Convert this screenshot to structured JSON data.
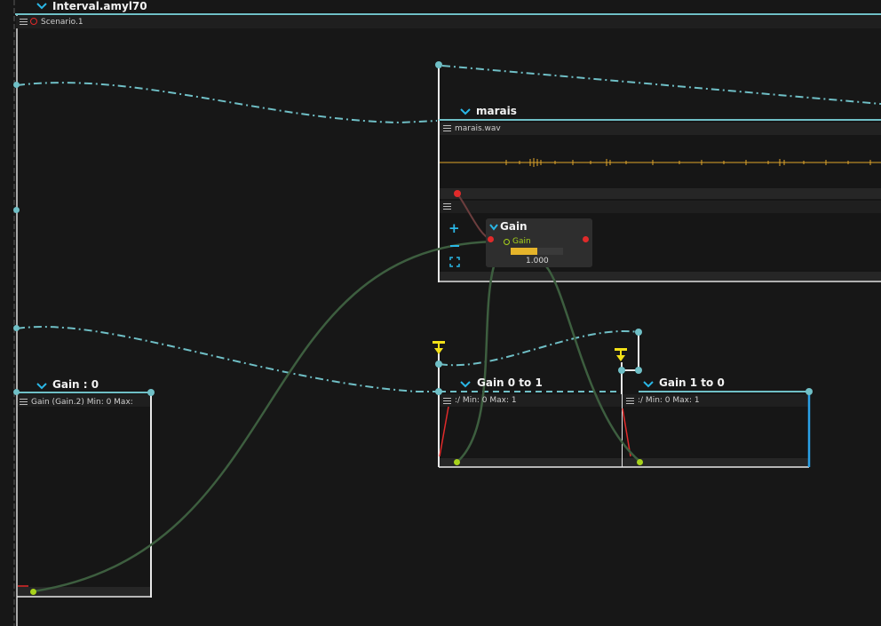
{
  "window": {
    "interval_title": "Interval.amyl70",
    "scenario_label": "Scenario.1"
  },
  "sound_process": {
    "title": "marais",
    "file_label": "marais.wav"
  },
  "gain_node": {
    "title": "Gain",
    "param_label": "Gain",
    "value": "1.000",
    "level": 0.5
  },
  "automations": [
    {
      "title": "Gain : 0",
      "info": "Gain (Gain.2)  Min: 0  Max:"
    },
    {
      "title": "Gain 0 to 1",
      "info": ":/  Min: 0  Max: 1"
    },
    {
      "title": "Gain 1 to 0",
      "info": ":/  Min: 0  Max: 1"
    }
  ],
  "icons": [
    "chevron-down-icon",
    "menu-icon",
    "plus-icon",
    "minus-icon",
    "fit-icon",
    "trigger-icon"
  ],
  "colors": {
    "background": "#171717",
    "interval_line": "#6fbfc6",
    "accent_cyan": "#2ab7e6",
    "cable_green": "#3d5e3f",
    "waveform": "#e0a52b",
    "gain_bar": "#e5b42a",
    "trigger": "#f2e018",
    "port_red": "#e02a2a",
    "port_green": "#a7d21b"
  }
}
